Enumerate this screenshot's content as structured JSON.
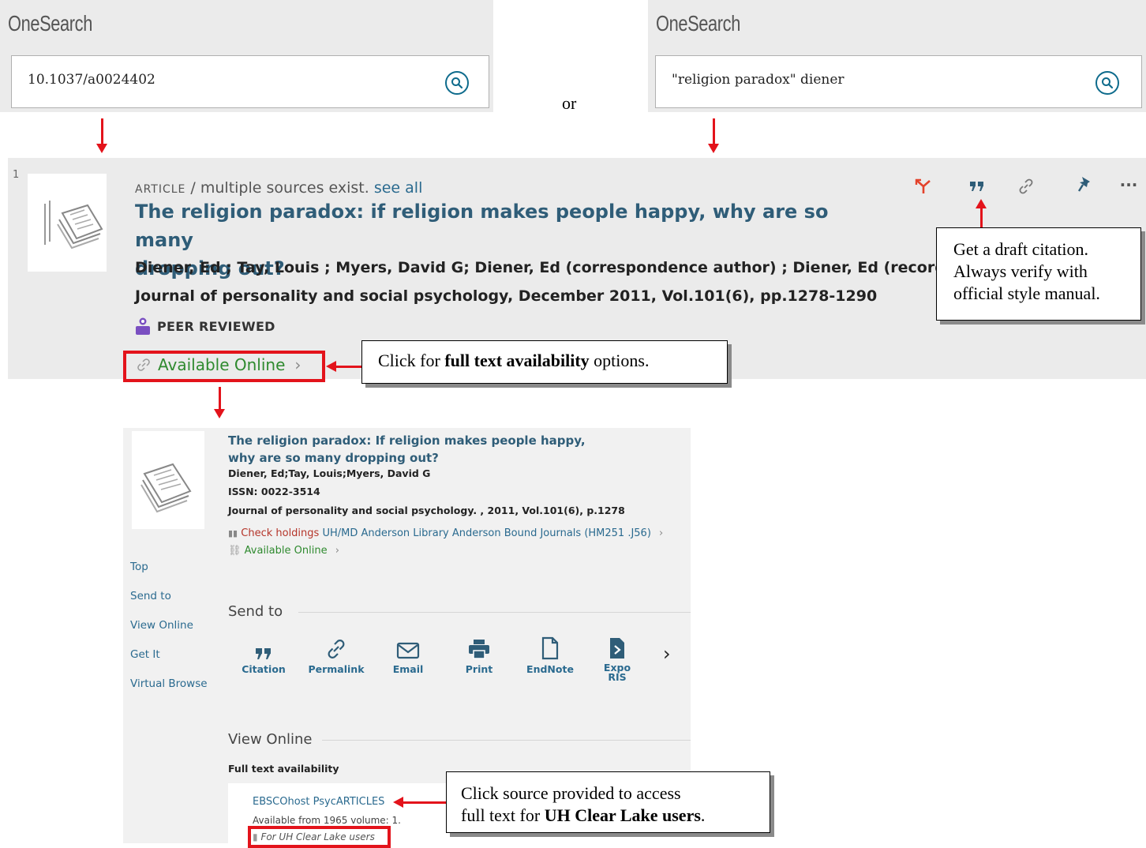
{
  "search_left": {
    "brand": "OneSearch",
    "query": "10.1037/a0024402"
  },
  "search_right": {
    "brand": "OneSearch",
    "query": "\"religion paradox\" diener"
  },
  "or_label": "or",
  "result": {
    "number": "1",
    "type_label": "ARTICLE",
    "type_rest": " / multiple sources exist. ",
    "see_all": "see all",
    "title_line1": "The religion paradox: if religion makes people happy, why are so many",
    "title_line2": "dropping out?",
    "authors": "Diener, Ed ; Tay, Louis ; Myers, David G; Diener, Ed (correspondence author) ; Diener, Ed (record own",
    "journal": "Journal of personality and social psychology, December 2011, Vol.101(6), pp.1278-1290",
    "peer_reviewed": "PEER REVIEWED",
    "available_online": "Available Online",
    "toolbar_icons": [
      "citation-trails-icon",
      "quote-icon",
      "link-icon",
      "pin-icon",
      "more-icon"
    ]
  },
  "callouts": {
    "citation": {
      "line1": "Get a draft citation.",
      "line2": "Always verify with",
      "line3": "official style manual."
    },
    "availability": {
      "pre": "Click for ",
      "bold": "full text availability",
      "post": " options."
    },
    "source": {
      "line1": "Click source provided to access",
      "line2_pre": "full text for ",
      "line2_bold": "UH Clear Lake users",
      "line2_post": "."
    }
  },
  "detail": {
    "title_line1": "The religion paradox: If religion makes people happy,",
    "title_line2": "why are so many dropping out?",
    "authors": "Diener, Ed;Tay, Louis;Myers, David G",
    "issn": "ISSN: 0022-3514",
    "journal": "Journal of personality and social psychology. , 2011, Vol.101(6), p.1278",
    "check_holdings": "Check holdings",
    "holdings_location": " UH/MD Anderson Library  Anderson Bound Journals (HM251 .J56)",
    "available_online": "Available Online",
    "side_nav": [
      "Top",
      "Send to",
      "View Online",
      "Get It",
      "Virtual Browse"
    ],
    "send_to_heading": "Send to",
    "send_items": [
      {
        "label": "Citation",
        "icon": "quote-icon"
      },
      {
        "label": "Permalink",
        "icon": "link-icon"
      },
      {
        "label": "Email",
        "icon": "email-icon"
      },
      {
        "label": "Print",
        "icon": "print-icon"
      },
      {
        "label": "EndNote",
        "icon": "document-icon"
      },
      {
        "label": "Expo",
        "label2": "RIS",
        "icon": "export-ris-icon"
      }
    ],
    "view_online_heading": "View Online",
    "full_text_label": "Full text availability",
    "source_name": "EBSCOhost PsycARTICLES",
    "available_from": "Available from 1965 volume: 1.",
    "for_users": "For UH Clear Lake users"
  },
  "colors": {
    "accent_red": "#e3131b",
    "link_blue": "#2a6a8f",
    "title_blue": "#2f5d78",
    "green": "#2f8a2f"
  }
}
